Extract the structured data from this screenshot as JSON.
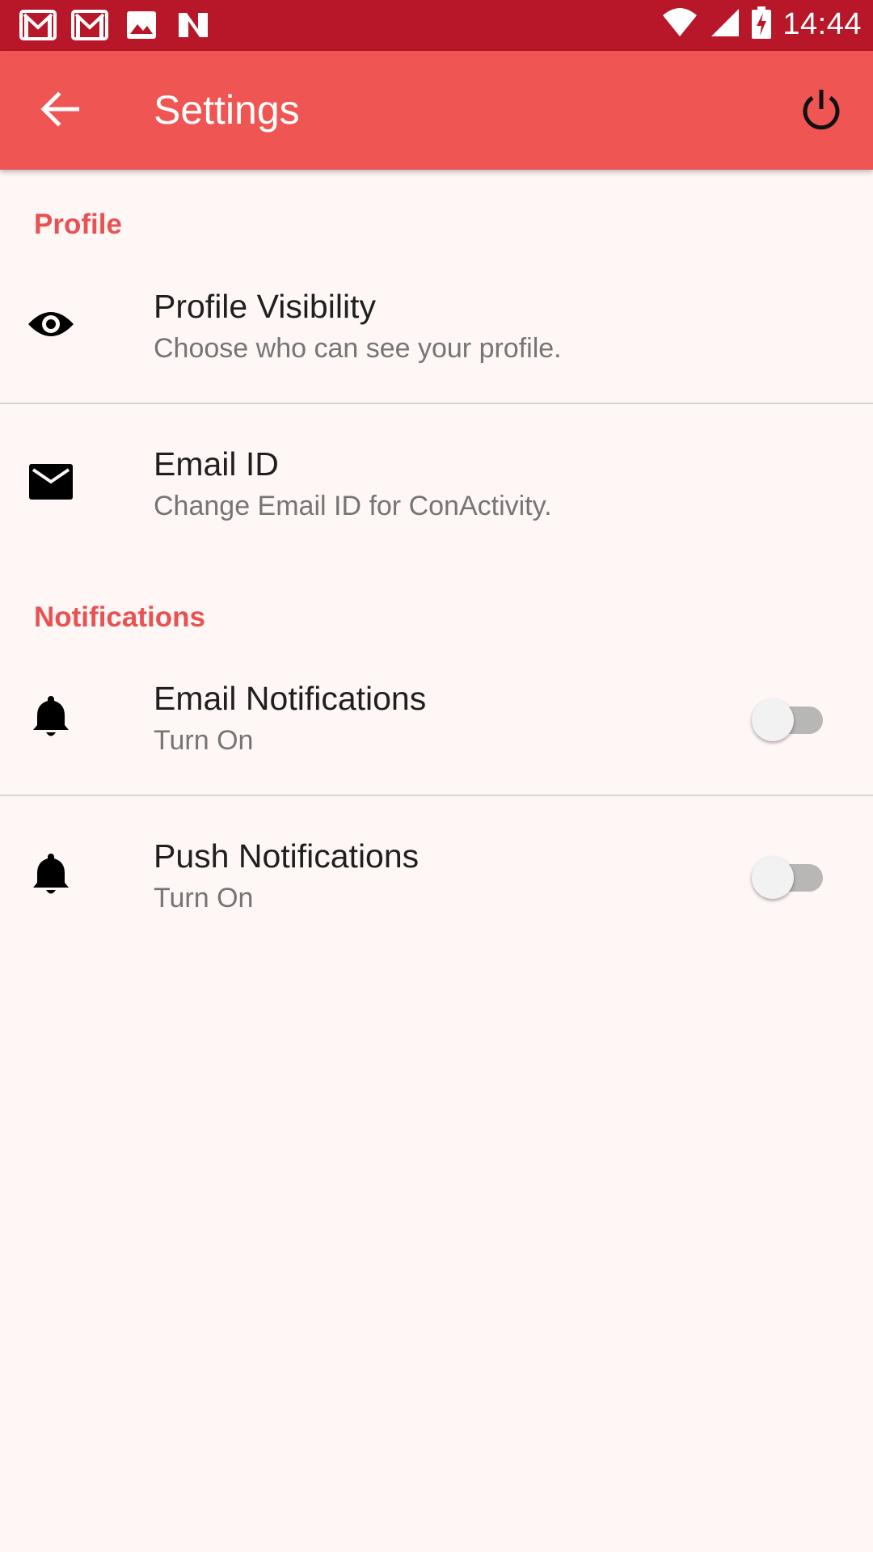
{
  "status_bar": {
    "time": "14:44",
    "left_icons": [
      "gmail-icon",
      "gmail-icon",
      "image-icon",
      "n-app-icon"
    ],
    "right_icons": [
      "wifi-icon",
      "signal-icon",
      "battery-charging-icon"
    ],
    "color": "#b81629"
  },
  "app_bar": {
    "title": "Settings",
    "back_icon": "arrow-back-icon",
    "power_icon": "power-icon",
    "color": "#ef5552"
  },
  "sections": {
    "profile": {
      "header": "Profile",
      "items": [
        {
          "title": "Profile Visibility",
          "subtitle": "Choose who can see your profile.",
          "icon": "eye-icon"
        },
        {
          "title": "Email ID",
          "subtitle": "Change Email ID for ConActivity.",
          "icon": "mail-icon"
        }
      ]
    },
    "notifications": {
      "header": "Notifications",
      "items": [
        {
          "title": "Email Notifications",
          "subtitle": "Turn On",
          "icon": "bell-icon",
          "enabled": false
        },
        {
          "title": "Push Notifications",
          "subtitle": "Turn On",
          "icon": "bell-icon",
          "enabled": false
        }
      ]
    }
  },
  "accent_color": "#e85252"
}
